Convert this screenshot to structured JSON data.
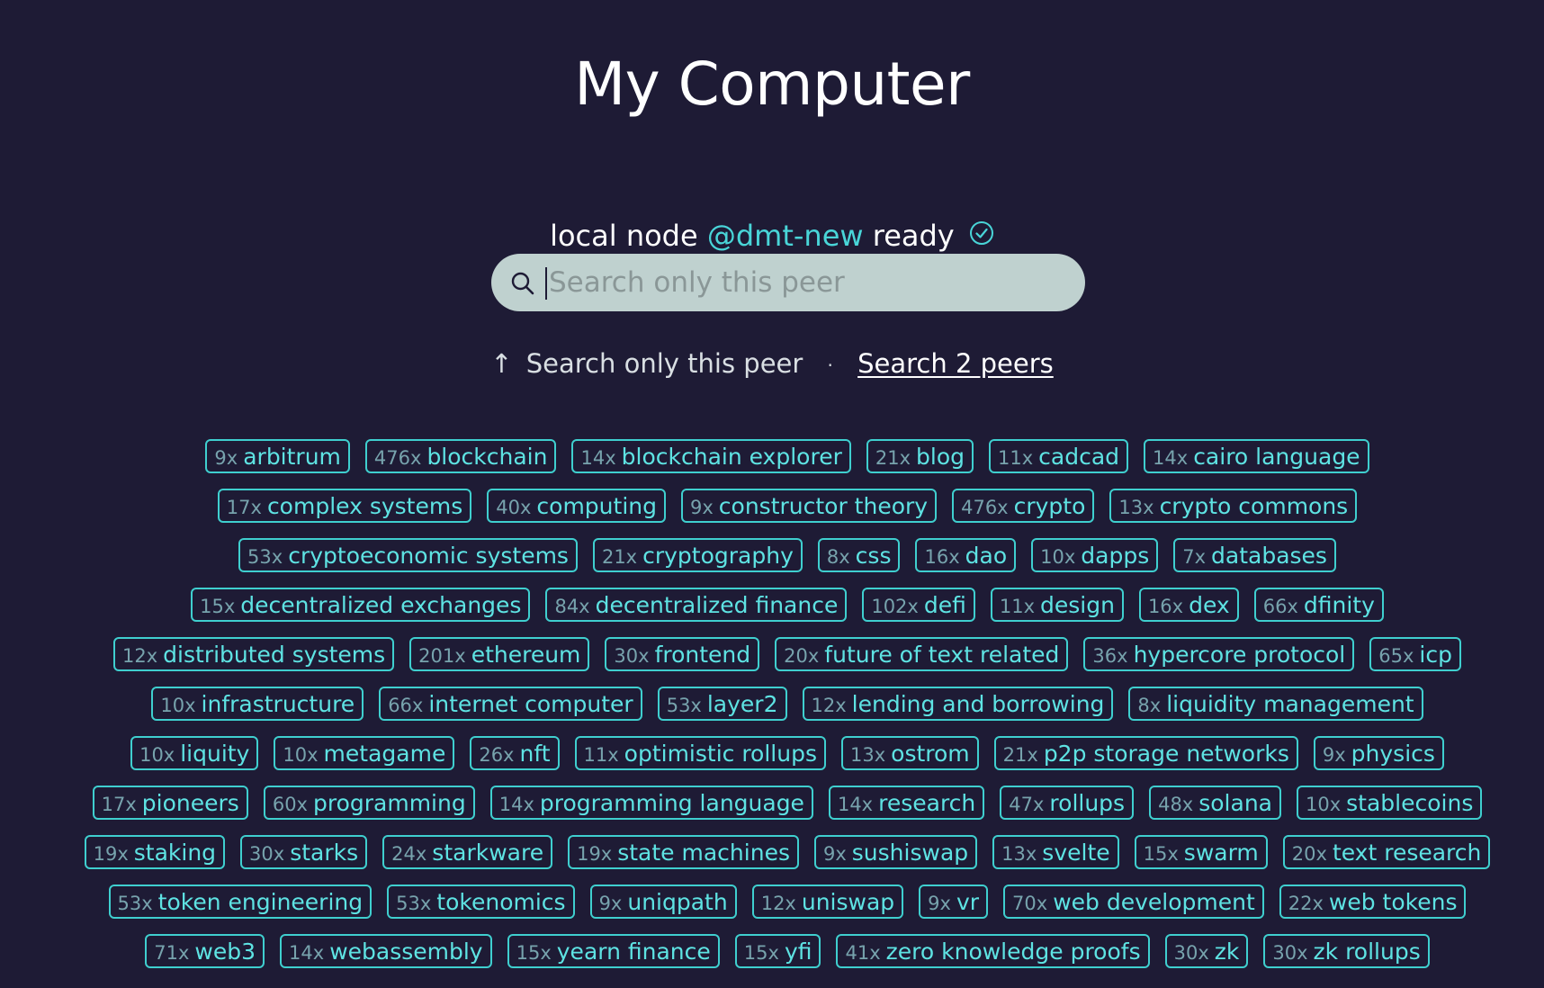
{
  "header": {
    "title": "My Computer"
  },
  "status": {
    "prefix": "local node",
    "handle": "@dmt-new",
    "suffix": "ready"
  },
  "search": {
    "placeholder": "Search only this peer",
    "value": ""
  },
  "scope": {
    "arrow": "↑",
    "current_label": "Search only this peer",
    "separator": "·",
    "peers_link_label": "Search 2 peers"
  },
  "colors": {
    "background": "#1e1b35",
    "accent": "#49d5d8",
    "tag_border": "#3fcfcf",
    "tag_text": "#5ee3e3",
    "tag_count": "#77a3ad",
    "search_bg": "#bfd1cf"
  },
  "icons": {
    "search": "search-icon",
    "ready": "check-circle-icon"
  },
  "tags": [
    {
      "count": "9x",
      "label": "arbitrum"
    },
    {
      "count": "476x",
      "label": "blockchain"
    },
    {
      "count": "14x",
      "label": "blockchain explorer"
    },
    {
      "count": "21x",
      "label": "blog"
    },
    {
      "count": "11x",
      "label": "cadcad"
    },
    {
      "count": "14x",
      "label": "cairo language"
    },
    {
      "count": "17x",
      "label": "complex systems"
    },
    {
      "count": "40x",
      "label": "computing"
    },
    {
      "count": "9x",
      "label": "constructor theory"
    },
    {
      "count": "476x",
      "label": "crypto"
    },
    {
      "count": "13x",
      "label": "crypto commons"
    },
    {
      "count": "53x",
      "label": "cryptoeconomic systems"
    },
    {
      "count": "21x",
      "label": "cryptography"
    },
    {
      "count": "8x",
      "label": "css"
    },
    {
      "count": "16x",
      "label": "dao"
    },
    {
      "count": "10x",
      "label": "dapps"
    },
    {
      "count": "7x",
      "label": "databases"
    },
    {
      "count": "15x",
      "label": "decentralized exchanges"
    },
    {
      "count": "84x",
      "label": "decentralized finance"
    },
    {
      "count": "102x",
      "label": "defi"
    },
    {
      "count": "11x",
      "label": "design"
    },
    {
      "count": "16x",
      "label": "dex"
    },
    {
      "count": "66x",
      "label": "dfinity"
    },
    {
      "count": "12x",
      "label": "distributed systems"
    },
    {
      "count": "201x",
      "label": "ethereum"
    },
    {
      "count": "30x",
      "label": "frontend"
    },
    {
      "count": "20x",
      "label": "future of text related"
    },
    {
      "count": "36x",
      "label": "hypercore protocol"
    },
    {
      "count": "65x",
      "label": "icp"
    },
    {
      "count": "10x",
      "label": "infrastructure"
    },
    {
      "count": "66x",
      "label": "internet computer"
    },
    {
      "count": "53x",
      "label": "layer2"
    },
    {
      "count": "12x",
      "label": "lending and borrowing"
    },
    {
      "count": "8x",
      "label": "liquidity management"
    },
    {
      "count": "10x",
      "label": "liquity"
    },
    {
      "count": "10x",
      "label": "metagame"
    },
    {
      "count": "26x",
      "label": "nft"
    },
    {
      "count": "11x",
      "label": "optimistic rollups"
    },
    {
      "count": "13x",
      "label": "ostrom"
    },
    {
      "count": "21x",
      "label": "p2p storage networks"
    },
    {
      "count": "9x",
      "label": "physics"
    },
    {
      "count": "17x",
      "label": "pioneers"
    },
    {
      "count": "60x",
      "label": "programming"
    },
    {
      "count": "14x",
      "label": "programming language"
    },
    {
      "count": "14x",
      "label": "research"
    },
    {
      "count": "47x",
      "label": "rollups"
    },
    {
      "count": "48x",
      "label": "solana"
    },
    {
      "count": "10x",
      "label": "stablecoins"
    },
    {
      "count": "19x",
      "label": "staking"
    },
    {
      "count": "30x",
      "label": "starks"
    },
    {
      "count": "24x",
      "label": "starkware"
    },
    {
      "count": "19x",
      "label": "state machines"
    },
    {
      "count": "9x",
      "label": "sushiswap"
    },
    {
      "count": "13x",
      "label": "svelte"
    },
    {
      "count": "15x",
      "label": "swarm"
    },
    {
      "count": "20x",
      "label": "text research"
    },
    {
      "count": "53x",
      "label": "token engineering"
    },
    {
      "count": "53x",
      "label": "tokenomics"
    },
    {
      "count": "9x",
      "label": "uniqpath"
    },
    {
      "count": "12x",
      "label": "uniswap"
    },
    {
      "count": "9x",
      "label": "vr"
    },
    {
      "count": "70x",
      "label": "web development"
    },
    {
      "count": "22x",
      "label": "web tokens"
    },
    {
      "count": "71x",
      "label": "web3"
    },
    {
      "count": "14x",
      "label": "webassembly"
    },
    {
      "count": "15x",
      "label": "yearn finance"
    },
    {
      "count": "15x",
      "label": "yfi"
    },
    {
      "count": "41x",
      "label": "zero knowledge proofs"
    },
    {
      "count": "30x",
      "label": "zk"
    },
    {
      "count": "30x",
      "label": "zk rollups"
    }
  ]
}
